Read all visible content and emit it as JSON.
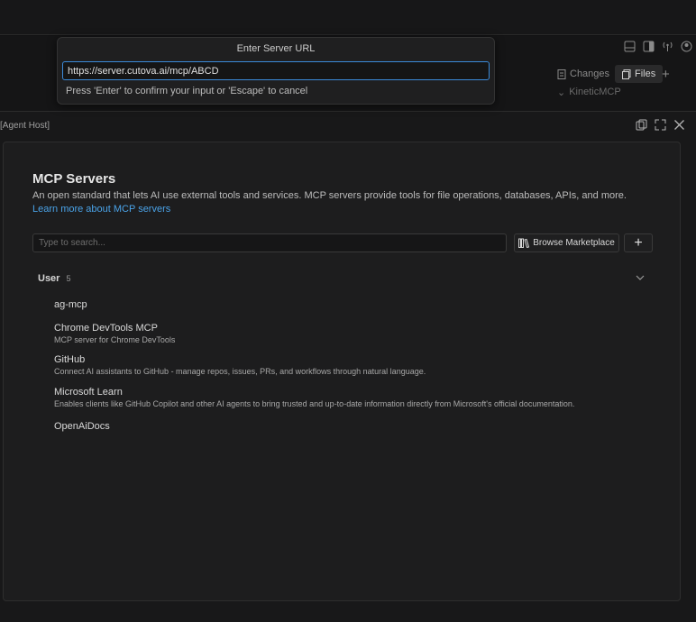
{
  "quick_input": {
    "title": "Enter Server URL",
    "value": "https://server.cutova.ai/mcp/ABCD",
    "hint": "Press 'Enter' to confirm your input or 'Escape' to cancel"
  },
  "background": {
    "tabs": {
      "changes": "Changes",
      "files": "Files"
    },
    "kinetic": "KineticMCP"
  },
  "panel": {
    "title": "[Agent Host]"
  },
  "mcp": {
    "title": "MCP Servers",
    "description": "An open standard that lets AI use external tools and services. MCP servers provide tools for file operations, databases, APIs, and more.",
    "link": "Learn more about MCP servers",
    "search_placeholder": "Type to search...",
    "browse_label": "Browse Marketplace",
    "add_label": "+"
  },
  "group": {
    "label": "User",
    "count": "5"
  },
  "servers": [
    {
      "name": "ag-mcp",
      "description": ""
    },
    {
      "name": "Chrome DevTools MCP",
      "description": "MCP server for Chrome DevTools"
    },
    {
      "name": "GitHub",
      "description": "Connect AI assistants to GitHub - manage repos, issues, PRs, and workflows through natural language."
    },
    {
      "name": "Microsoft Learn",
      "description": "Enables clients like GitHub Copilot and other AI agents to bring trusted and up-to-date information directly from Microsoft's official documentation."
    },
    {
      "name": "OpenAiDocs",
      "description": ""
    }
  ]
}
